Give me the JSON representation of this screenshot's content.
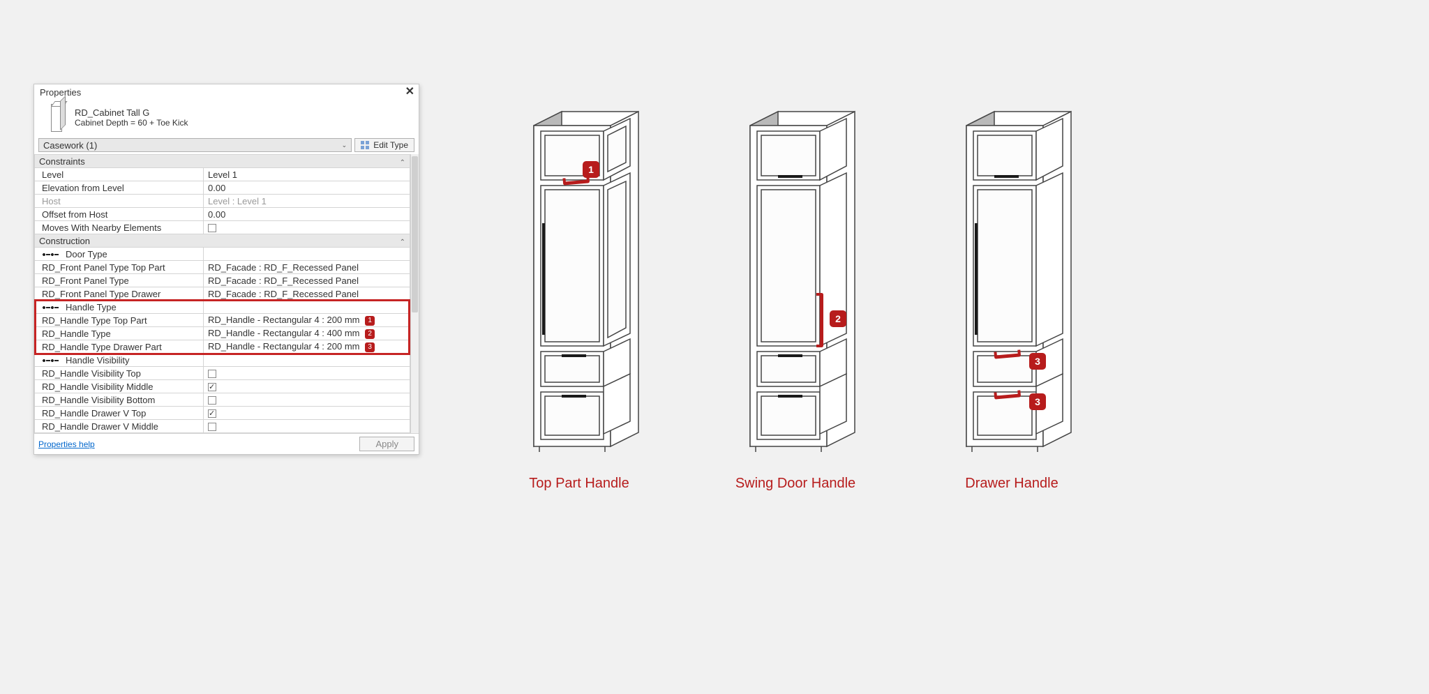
{
  "panel": {
    "title": "Properties",
    "type_name": "RD_Cabinet Tall G",
    "type_sub": "Cabinet Depth = 60 + Toe Kick",
    "selector": "Casework (1)",
    "edit_type": "Edit Type",
    "help": "Properties help",
    "apply": "Apply"
  },
  "sections": {
    "constraints": {
      "title": "Constraints",
      "rows": [
        {
          "label": "Level",
          "value": "Level 1"
        },
        {
          "label": "Elevation from Level",
          "value": "0.00"
        },
        {
          "label": "Host",
          "value": "Level : Level 1",
          "grey": true
        },
        {
          "label": "Offset from Host",
          "value": "0.00"
        },
        {
          "label": "Moves With Nearby Elements",
          "value": "",
          "check": false
        }
      ]
    },
    "construction": {
      "title": "Construction",
      "door_type": "Door Type",
      "front_panel": [
        {
          "label": "RD_Front Panel Type Top Part<Casework>",
          "value": "RD_Facade : RD_F_Recessed Panel"
        },
        {
          "label": "RD_Front Panel Type<Casework>",
          "value": "RD_Facade : RD_F_Recessed Panel"
        },
        {
          "label": "RD_Front Panel Type Drawer<Casework>",
          "value": "RD_Facade : RD_F_Recessed Panel"
        }
      ],
      "handle_type_header": "Handle Type",
      "handle_type": [
        {
          "label": "RD_Handle Type Top Part<Casework>",
          "value": "RD_Handle - Rectangular 4 : 200 mm",
          "badge": "1"
        },
        {
          "label": "RD_Handle Type<Casework>",
          "value": "RD_Handle - Rectangular 4 : 400 mm",
          "badge": "2"
        },
        {
          "label": "RD_Handle Type Drawer Part<Casework>",
          "value": "RD_Handle - Rectangular 4 : 200 mm",
          "badge": "3"
        }
      ],
      "handle_vis_header": "Handle Visibility",
      "handle_vis": [
        {
          "label": "RD_Handle Visibility Top",
          "check": false
        },
        {
          "label": "RD_Handle Visibility Middle",
          "check": true
        },
        {
          "label": "RD_Handle Visibility Bottom",
          "check": false
        },
        {
          "label": "RD_Handle Drawer V Top",
          "check": true
        },
        {
          "label": "RD_Handle Drawer V Middle",
          "check": false
        }
      ]
    }
  },
  "cabinets": {
    "c1": {
      "label": "Top Part Handle",
      "badge": "1"
    },
    "c2": {
      "label": "Swing Door Handle",
      "badge": "2"
    },
    "c3": {
      "label": "Drawer Handle",
      "badge": "3"
    }
  },
  "colors": {
    "accent": "#b71c1c"
  }
}
